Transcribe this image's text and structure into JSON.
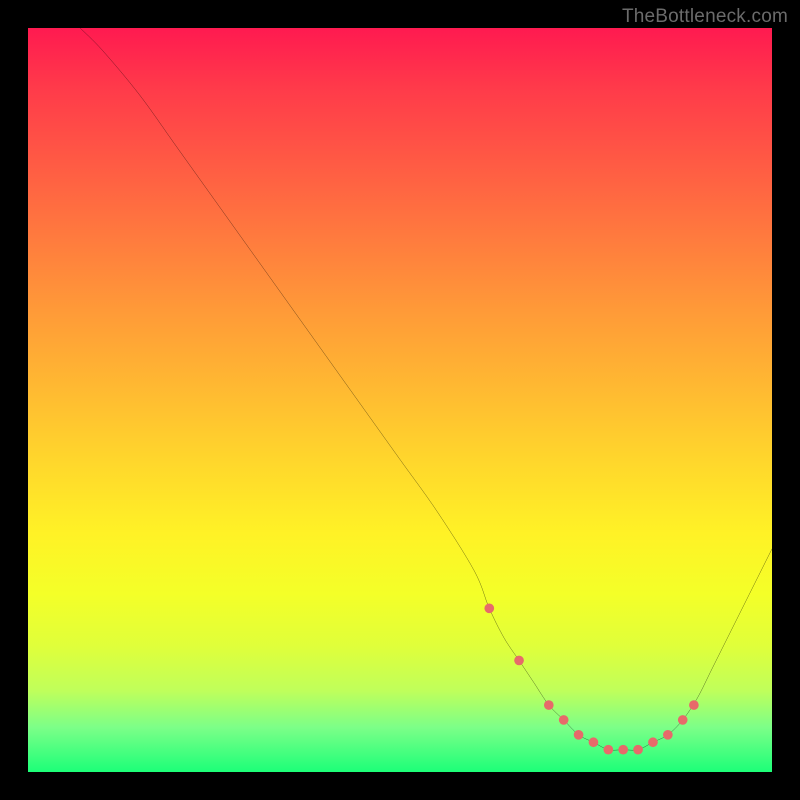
{
  "attribution": "TheBottleneck.com",
  "colors": {
    "frame": "#000000",
    "curve": "#000000",
    "markers": "#e76a6a",
    "gradient_top": "#ff1a50",
    "gradient_bottom": "#1cff78"
  },
  "chart_data": {
    "type": "line",
    "title": "",
    "xlabel": "",
    "ylabel": "",
    "xlim": [
      0,
      100
    ],
    "ylim": [
      0,
      100
    ],
    "x": [
      7,
      10,
      15,
      20,
      25,
      30,
      35,
      40,
      45,
      50,
      55,
      60,
      62,
      64,
      66,
      68,
      70,
      72,
      74,
      76,
      78,
      80,
      82,
      84,
      86,
      88,
      90,
      92,
      95,
      100
    ],
    "y": [
      100,
      97,
      91,
      84,
      77,
      70,
      63,
      56,
      49,
      42,
      35,
      27,
      22,
      18,
      15,
      12,
      9,
      7,
      5,
      4,
      3,
      3,
      3,
      4,
      5,
      7,
      10,
      14,
      20,
      30
    ],
    "markers": {
      "x": [
        62,
        66,
        70,
        72,
        74,
        76,
        78,
        80,
        82,
        84,
        86,
        88,
        89.5
      ],
      "y": [
        22,
        15,
        9,
        7,
        5,
        4,
        3,
        3,
        3,
        4,
        5,
        7,
        9
      ]
    },
    "annotations": []
  }
}
